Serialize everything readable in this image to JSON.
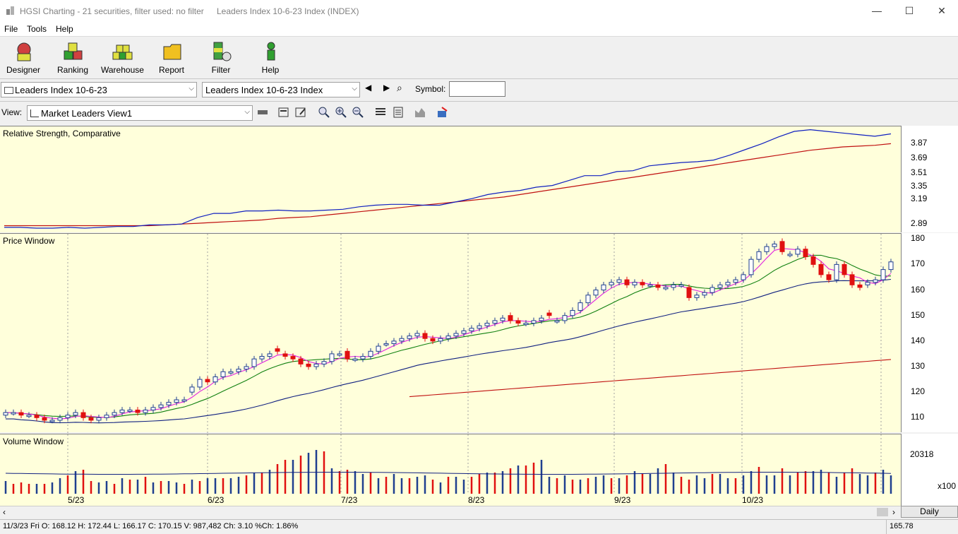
{
  "window": {
    "title": "HGSI Charting - 21 securities, filter used: no filter",
    "subtitle": "Leaders Index 10-6-23 Index (INDEX)",
    "min_glyph": "—",
    "max_glyph": "☐",
    "close_glyph": "✕"
  },
  "menu": [
    "File",
    "Tools",
    "Help"
  ],
  "toolbar": [
    {
      "label": "Designer",
      "icon": "designer-icon",
      "color": "#d04040"
    },
    {
      "label": "Ranking",
      "icon": "ranking-icon",
      "color": "#30a030"
    },
    {
      "label": "Warehouse",
      "icon": "warehouse-icon",
      "color": "#e0d020"
    },
    {
      "label": "Report",
      "icon": "report-icon",
      "color": "#f0c020"
    },
    {
      "label": "Filter",
      "icon": "filter-icon",
      "color": "#40a040"
    },
    {
      "label": "Help",
      "icon": "help-icon",
      "color": "#30a030"
    }
  ],
  "selectors": {
    "list_combo": "Leaders Index 10-6-23",
    "symbol_combo": "Leaders Index 10-6-23 Index",
    "symbol_label": "Symbol:",
    "symbol_value": "",
    "view_label": "View:",
    "view_combo": "Market Leaders View1"
  },
  "panels": {
    "rs_title": "Relative Strength, Comparative",
    "price_title": "Price Window",
    "volume_title": "Volume Window"
  },
  "colors": {
    "panel_bg": "#ffffdb",
    "up": "#1f3f8f",
    "down": "#e01010",
    "ma_fast": "#e020e0",
    "ma_mid": "#108010",
    "ma_slow": "#102080",
    "ma_long": "#c01010"
  },
  "chart_data": {
    "type": "candlestick",
    "x_labels": [
      "5/23",
      "6/23",
      "7/23",
      "8/23",
      "9/23",
      "10/23"
    ],
    "rs": {
      "y_ticks": [
        "3.87",
        "3.69",
        "3.51",
        "3.35",
        "3.19",
        "2.89"
      ],
      "line": [
        2.85,
        2.85,
        2.84,
        2.84,
        2.85,
        2.84,
        2.85,
        2.86,
        2.86,
        2.88,
        2.88,
        2.89,
        2.97,
        3.02,
        3.02,
        3.05,
        3.05,
        3.06,
        3.05,
        3.05,
        3.06,
        3.07,
        3.1,
        3.12,
        3.13,
        3.13,
        3.12,
        3.12,
        3.16,
        3.2,
        3.25,
        3.28,
        3.3,
        3.34,
        3.36,
        3.42,
        3.48,
        3.48,
        3.53,
        3.54,
        3.6,
        3.62,
        3.64,
        3.65,
        3.67,
        3.73,
        3.8,
        3.87,
        3.95,
        4.02,
        4.04,
        4.02,
        4.0,
        3.98,
        3.96,
        3.99
      ],
      "ma": [
        2.87,
        2.87,
        2.87,
        2.87,
        2.87,
        2.87,
        2.87,
        2.87,
        2.87,
        2.87,
        2.88,
        2.89,
        2.9,
        2.91,
        2.92,
        2.93,
        2.94,
        2.96,
        2.97,
        2.98,
        3.0,
        3.02,
        3.04,
        3.06,
        3.08,
        3.1,
        3.12,
        3.14,
        3.16,
        3.18,
        3.2,
        3.22,
        3.25,
        3.28,
        3.31,
        3.34,
        3.37,
        3.4,
        3.43,
        3.46,
        3.49,
        3.52,
        3.55,
        3.58,
        3.61,
        3.64,
        3.67,
        3.7,
        3.73,
        3.76,
        3.79,
        3.81,
        3.83,
        3.84,
        3.85,
        3.87
      ]
    },
    "price": {
      "y_ticks": [
        "180",
        "170",
        "160",
        "150",
        "140",
        "130",
        "120",
        "110"
      ],
      "ylim": [
        104,
        182
      ],
      "close": [
        112,
        112,
        111,
        111,
        110,
        109,
        109,
        110,
        111,
        112,
        110,
        109,
        110,
        111,
        112,
        113,
        113,
        112,
        113,
        114,
        115,
        116,
        117,
        117,
        122,
        125,
        124,
        126,
        128,
        128,
        129,
        130,
        133,
        134,
        135,
        136,
        134,
        133,
        131,
        130,
        131,
        132,
        135,
        135,
        133,
        133,
        134,
        136,
        138,
        139,
        140,
        141,
        142,
        143,
        141,
        140,
        141,
        142,
        143,
        144,
        145,
        146,
        147,
        148,
        149,
        148,
        147,
        147,
        148,
        149,
        150,
        148,
        150,
        152,
        155,
        158,
        160,
        162,
        163,
        164,
        162,
        163,
        162,
        162,
        161,
        161,
        162,
        162,
        157,
        158,
        159,
        161,
        162,
        163,
        164,
        166,
        172,
        175,
        177,
        178,
        175,
        174,
        176,
        173,
        170,
        166,
        164,
        170,
        166,
        162,
        161,
        163,
        164,
        168,
        171
      ],
      "open": [
        111,
        112,
        112,
        111,
        111,
        110,
        109,
        109,
        110,
        111,
        112,
        110,
        109,
        110,
        111,
        112,
        113,
        113,
        112,
        113,
        114,
        115,
        116,
        117,
        120,
        122,
        125,
        124,
        126,
        128,
        128,
        129,
        130,
        133,
        134,
        137,
        135,
        134,
        133,
        131,
        130,
        131,
        132,
        135,
        136,
        133,
        133,
        134,
        136,
        139,
        139,
        140,
        141,
        142,
        143,
        141,
        140,
        141,
        142,
        143,
        144,
        145,
        146,
        147,
        148,
        150,
        148,
        147,
        147,
        148,
        151,
        148,
        148,
        150,
        152,
        155,
        158,
        160,
        162,
        163,
        164,
        162,
        163,
        162,
        162,
        161,
        161,
        162,
        161,
        157,
        158,
        159,
        161,
        162,
        163,
        164,
        166,
        172,
        175,
        177,
        179,
        174,
        174,
        176,
        173,
        170,
        166,
        164,
        170,
        166,
        162,
        162,
        163,
        164,
        168
      ]
    },
    "volume": {
      "y_ticks": [
        "20318"
      ],
      "unit_label": "x100",
      "bars_up": [
        1,
        0,
        0,
        0,
        1,
        0,
        1,
        1,
        0,
        1,
        0,
        0,
        1,
        1,
        0,
        1,
        0,
        1,
        0,
        1,
        0,
        1,
        1,
        0,
        1,
        0,
        1,
        1,
        0,
        1,
        1,
        0,
        1,
        0,
        1,
        0,
        0,
        1,
        0,
        1,
        1,
        0,
        1,
        0,
        0,
        1,
        1,
        0,
        1,
        0,
        1,
        1,
        0,
        1,
        1,
        0,
        1,
        0,
        1,
        1,
        0,
        0,
        1,
        0,
        1,
        0,
        1,
        0,
        0,
        1,
        1,
        0,
        1,
        0,
        1,
        0,
        1,
        1,
        0,
        1,
        0,
        1,
        0,
        1,
        1,
        0,
        1,
        0,
        0,
        1,
        1,
        0,
        1,
        1,
        0,
        1,
        1,
        0,
        1,
        1,
        0,
        1,
        0,
        0,
        1,
        1,
        0,
        1,
        0,
        0,
        1,
        1,
        0,
        1,
        1
      ],
      "heights": [
        18,
        14,
        16,
        14,
        14,
        14,
        16,
        22,
        26,
        32,
        34,
        18,
        16,
        18,
        14,
        22,
        20,
        20,
        24,
        16,
        18,
        18,
        16,
        14,
        20,
        18,
        22,
        22,
        22,
        22,
        24,
        26,
        30,
        30,
        34,
        42,
        48,
        48,
        54,
        58,
        62,
        60,
        36,
        32,
        34,
        32,
        28,
        30,
        22,
        24,
        28,
        22,
        22,
        24,
        26,
        20,
        16,
        24,
        24,
        20,
        24,
        28,
        30,
        30,
        32,
        36,
        40,
        40,
        44,
        48,
        24,
        22,
        26,
        20,
        20,
        22,
        24,
        26,
        22,
        22,
        26,
        32,
        28,
        28,
        36,
        42,
        30,
        24,
        20,
        26,
        22,
        28,
        28,
        22,
        22,
        26,
        32,
        38,
        26,
        26,
        36,
        26,
        30,
        32,
        32,
        34,
        30,
        24,
        30,
        36,
        28,
        26,
        30,
        34,
        26
      ]
    },
    "status": {
      "ohlc": "11/3/23 Fri O: 168.12 H: 172.44 L: 166.17 C: 170.15 V: 987,482 Ch: 3.10 %Ch: 1.86%",
      "right_value": "165.78",
      "period": "Daily"
    }
  }
}
